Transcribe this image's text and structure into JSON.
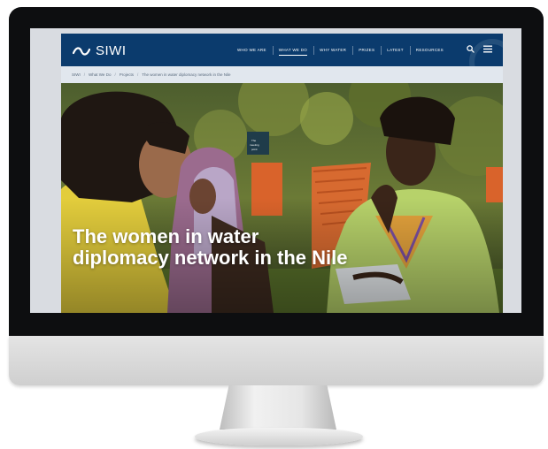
{
  "site": {
    "logo_text": "SIWI",
    "nav": [
      "WHO WE ARE",
      "WHAT WE DO",
      "WHY WATER",
      "PRIZES",
      "LATEST",
      "RESOURCES"
    ],
    "active_nav_index": 1,
    "breadcrumb": [
      "SIWI",
      "What We Do",
      "Projects",
      "The women in water diplomacy network in the Nile"
    ],
    "hero_title": "The women in water diplomacy network in the Nile"
  },
  "icons": {
    "logo": "wave-logo-icon",
    "search": "search-icon",
    "menu": "hamburger-menu-icon"
  },
  "colors": {
    "header": "#0b3b6d",
    "breadcrumb_bg": "#e1e7ee",
    "monitor_bezel": "#0d0e10"
  }
}
